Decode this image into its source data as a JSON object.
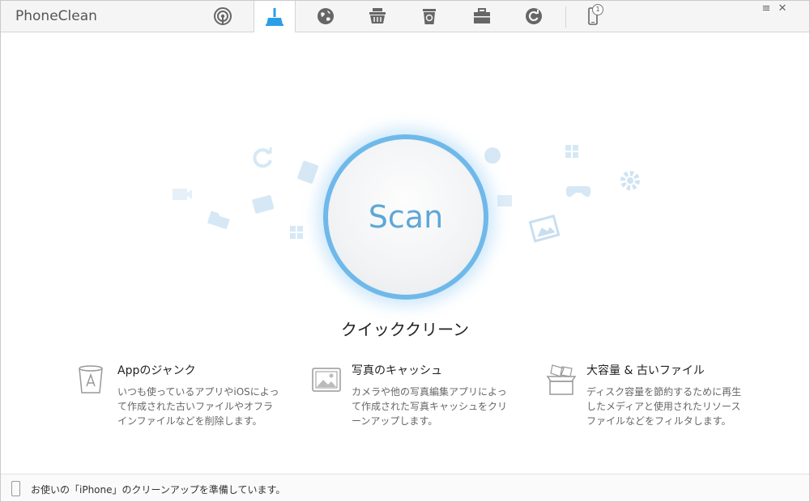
{
  "window": {
    "title": "PhoneClean"
  },
  "tabs": [
    {
      "icon": "signal-icon"
    },
    {
      "icon": "broom-icon",
      "active": true
    },
    {
      "icon": "globe-icon"
    },
    {
      "icon": "basket-icon"
    },
    {
      "icon": "recycle-bin-icon"
    },
    {
      "icon": "toolbox-icon"
    },
    {
      "icon": "restore-icon"
    },
    {
      "icon": "phone-icon"
    }
  ],
  "device": {
    "count": "1"
  },
  "window_controls": {
    "menu": "≡",
    "close": "✕"
  },
  "scan": {
    "label": "Scan"
  },
  "section": {
    "title": "クイッククリーン"
  },
  "features": [
    {
      "icon": "trash-app-icon",
      "title": "Appのジャンク",
      "desc": "いつも使っているアプリやiOSによって作成された古いファイルやオフラインファイルなどを削除します。"
    },
    {
      "icon": "photo-icon",
      "title": "写真のキャッシュ",
      "desc": "カメラや他の写真編集アプリによって作成された写真キャッシュをクリーンアップします。"
    },
    {
      "icon": "box-icon",
      "title": "大容量 & 古いファイル",
      "desc": "ディスク容量を節約するために再生したメディアと使用されたリソースファイルなどをフィルタします。"
    }
  ],
  "status": {
    "text": "お使いの「iPhone」のクリーンアップを準備しています。"
  },
  "colors": {
    "accent": "#2a9ee8",
    "scan_ring": "#6fb9ea",
    "scan_text": "#5ea7d6"
  }
}
